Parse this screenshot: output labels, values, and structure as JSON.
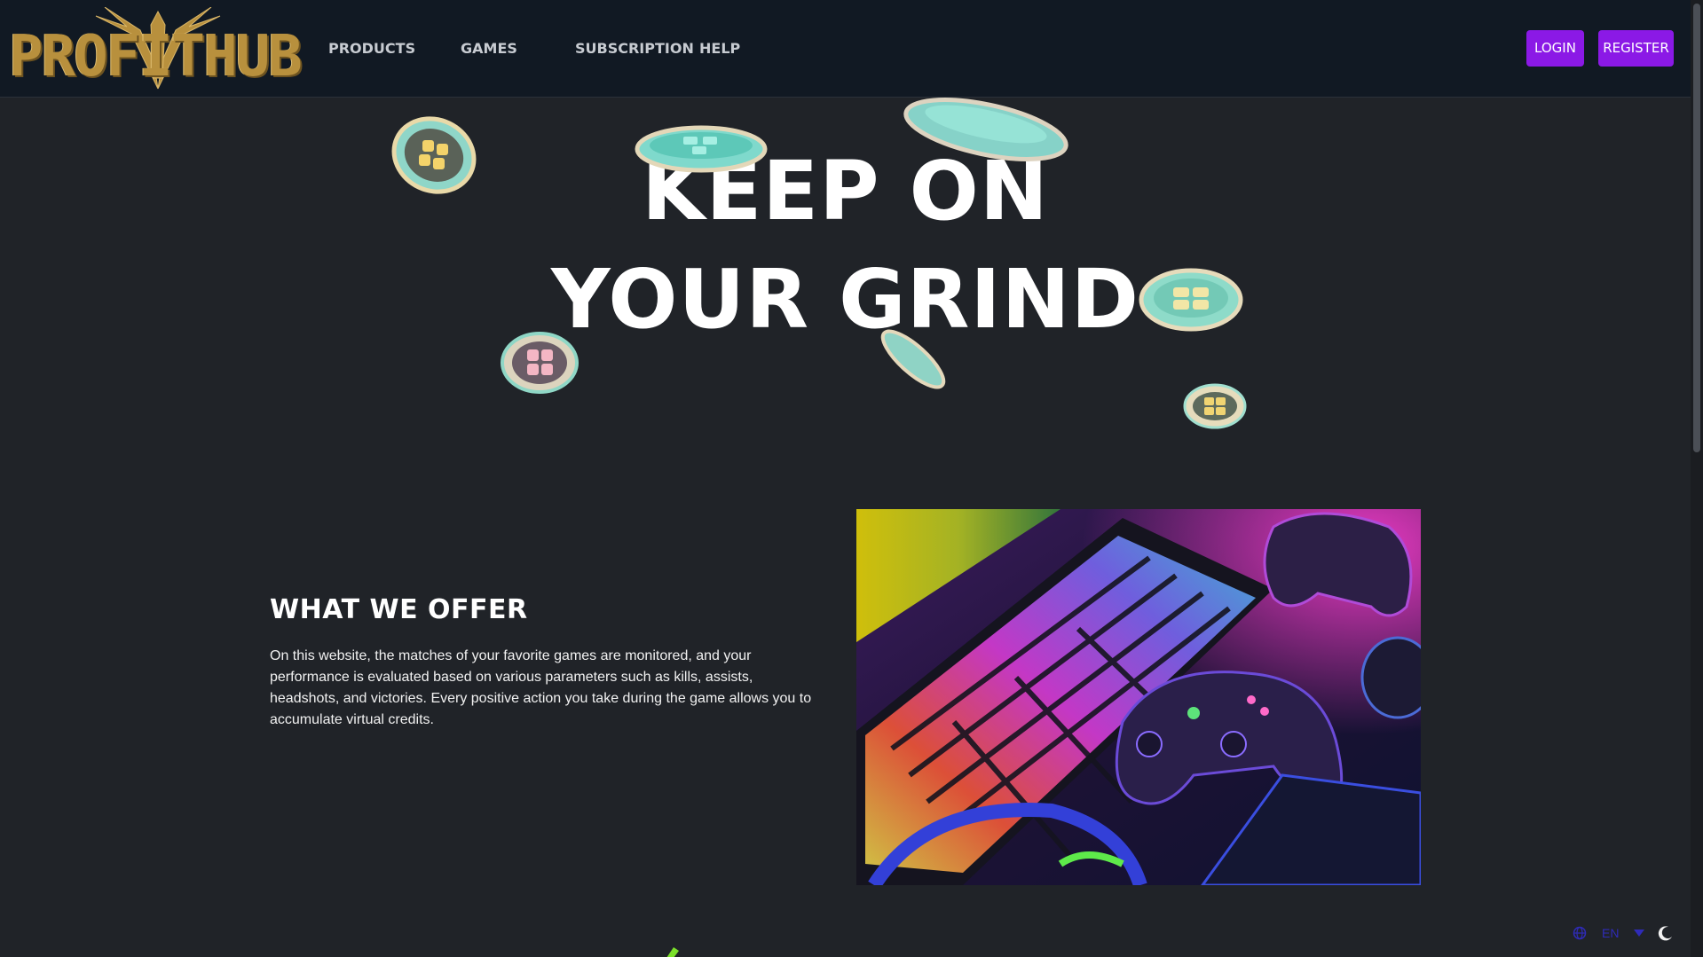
{
  "brand": {
    "logo_text": "PROFITHUB",
    "logo_color": "#b8903d"
  },
  "nav": {
    "products": "PRODUCTS",
    "games": "GAMES",
    "subscription": "SUBSCRIPTION",
    "help": "HELP"
  },
  "auth": {
    "login": "LOGIN",
    "register": "REGISTER",
    "accent": "#8b19e6"
  },
  "hero": {
    "line1": "KEEP ON",
    "line2": "YOUR GRIND",
    "decoration": "coin-icon"
  },
  "offer": {
    "title": "WHAT WE OFFER",
    "text": "On this website, the matches of your favorite games are monitored, and your performance is evaluated based on various parameters such as kills, assists, headshots, and victories. Every positive action you take during the game allows you to accumulate virtual credits.",
    "image": "gaming-setup-image"
  },
  "footer": {
    "language_code": "EN",
    "icons": [
      "globe-icon",
      "chevron-down-icon",
      "moon-icon"
    ]
  },
  "colors": {
    "background": "#202328",
    "header": "#111923",
    "language": "#2f2bb8"
  }
}
